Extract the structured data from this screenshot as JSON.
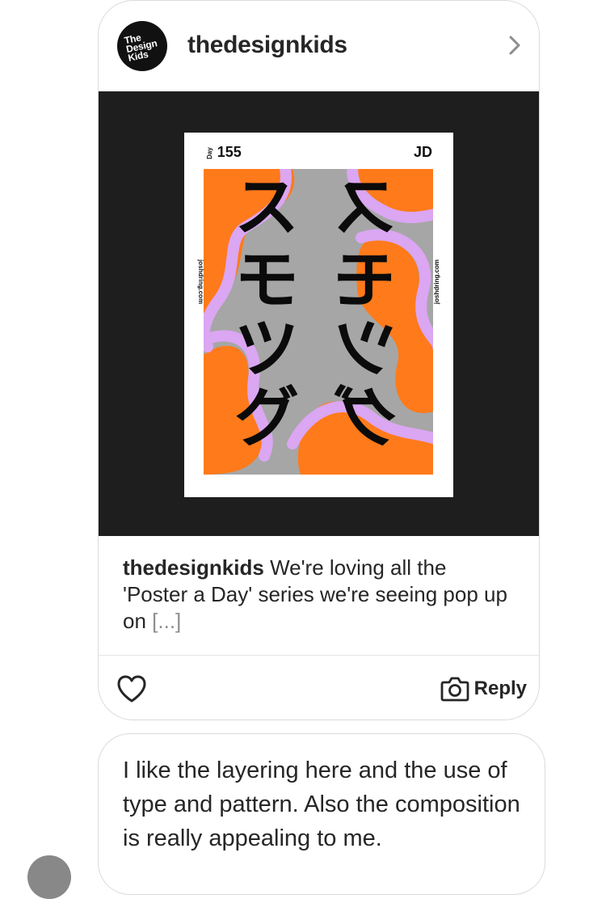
{
  "post": {
    "username": "thedesignkids",
    "avatar_text": "The\nDesign\nKids",
    "poster": {
      "day_label": "Day",
      "day_number": "155",
      "initials": "JD",
      "side_text_left": "joshdring.com",
      "side_text_right": "joshdring.com",
      "glyphs": [
        "ス",
        "ス",
        "モ",
        "モ",
        "ツ",
        "ツ",
        "グ",
        "グ"
      ]
    },
    "caption": {
      "username": "thedesignkids",
      "text": "We're loving all the 'Poster a Day' series we're seeing pop up on",
      "more": "[...]"
    },
    "actions": {
      "reply_label": "Reply"
    }
  },
  "message": {
    "text": "I like the layering here and the use of type and pattern. Also the composition is really appealing to me."
  },
  "colors": {
    "border": "#dbdbdb",
    "text": "#262626",
    "muted": "#8e8e8e",
    "poster_orange": "#ff7a1a",
    "poster_purple": "#dba6f2",
    "poster_gray": "#a6a6a6",
    "image_bg": "#1e1e1e"
  },
  "icons": {
    "chevron": "chevron-right-icon",
    "heart": "heart-icon",
    "camera": "camera-icon"
  }
}
